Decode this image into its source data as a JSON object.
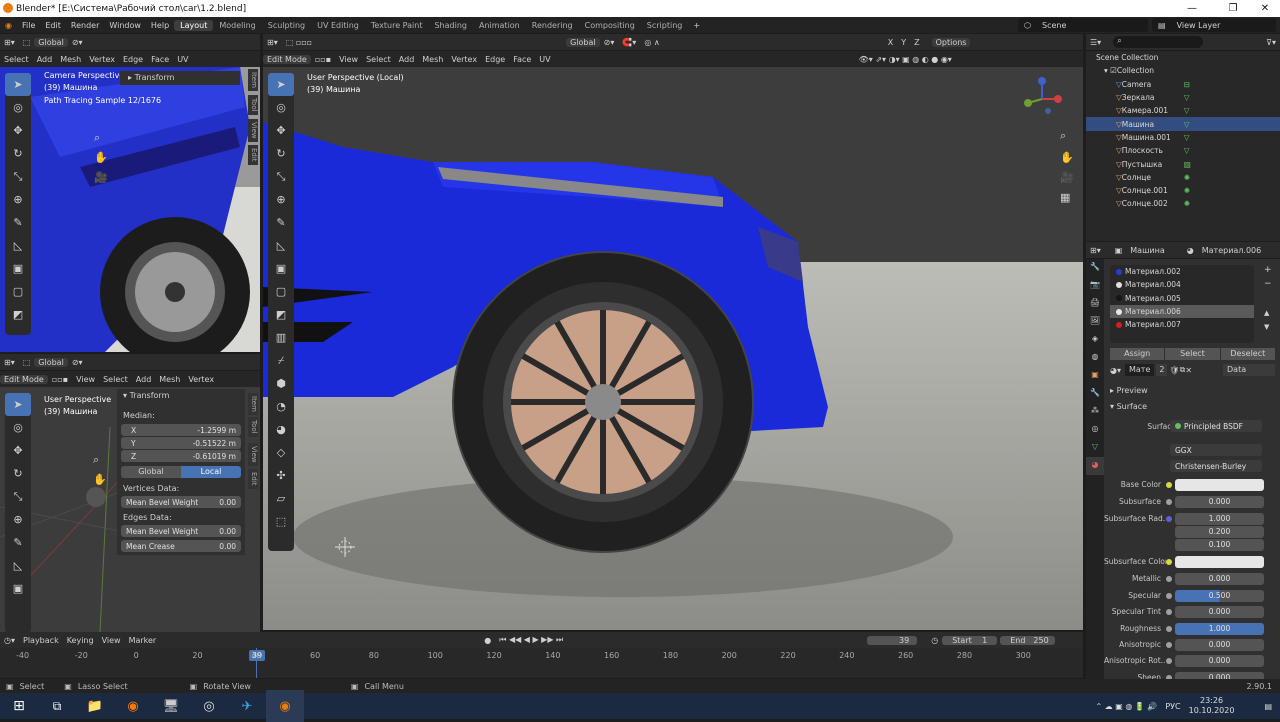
{
  "window": {
    "title": "Blender* [E:\\Система\\Рабочий стол\\car\\1.2.blend]",
    "minimize": "—",
    "maximize": "❐",
    "close": "✕"
  },
  "menu": {
    "items": [
      "File",
      "Edit",
      "Render",
      "Window",
      "Help"
    ],
    "workspaces": [
      "Layout",
      "Modeling",
      "Sculpting",
      "UV Editing",
      "Texture Paint",
      "Shading",
      "Animation",
      "Rendering",
      "Compositing",
      "Scripting"
    ],
    "active_workspace": "Layout",
    "add_tab": "+",
    "scene": "Scene",
    "view_layer": "View Layer"
  },
  "topleft_vp": {
    "orientation": "Global",
    "mode_menu": [
      "Select",
      "Add",
      "Mesh",
      "Vertex",
      "Edge",
      "Face",
      "UV"
    ],
    "info": [
      "Camera Perspective",
      "(39) Машина",
      "Path Tracing Sample 12/1676"
    ],
    "npanel_title": "Transform",
    "tabs": [
      "Item",
      "Tool",
      "View",
      "Edit"
    ]
  },
  "main_vp": {
    "mode": "Edit Mode",
    "menus": [
      "View",
      "Select",
      "Add",
      "Mesh",
      "Vertex",
      "Edge",
      "Face",
      "UV"
    ],
    "orientation": "Global",
    "info": [
      "User Perspective (Local)",
      "(39) Машина"
    ],
    "axes": [
      "X",
      "Y",
      "Z"
    ],
    "options": "Options"
  },
  "bottomleft_vp": {
    "orientation": "Global",
    "mode": "Edit Mode",
    "menus": [
      "View",
      "Select",
      "Add",
      "Mesh",
      "Vertex"
    ],
    "info": [
      "User Perspective",
      "(39) Машина"
    ],
    "tabs": [
      "Item",
      "Tool",
      "View",
      "Edit"
    ],
    "transform": {
      "title": "Transform",
      "median": "Median:",
      "fields": [
        {
          "label": "X",
          "value": "-1.2599 m"
        },
        {
          "label": "Y",
          "value": "-0.51522 m"
        },
        {
          "label": "Z",
          "value": "-0.61019 m"
        }
      ],
      "global": "Global",
      "local": "Local",
      "vertices_data": "Vertices Data:",
      "mean_bevel_weight_label": "Mean Bevel Weight",
      "mean_bevel_weight_v": "0.00",
      "edges_data": "Edges Data:",
      "edge_bevel_label": "Mean Bevel Weight",
      "edge_bevel_v": "0.00",
      "crease_label": "Mean Crease",
      "crease_v": "0.00"
    }
  },
  "outliner": {
    "root": "Scene Collection",
    "collection": "Collection",
    "items": [
      {
        "name": "Camera",
        "color": "#6a9bd8"
      },
      {
        "name": "Зеркала",
        "color": "#e0a060"
      },
      {
        "name": "Камера.001",
        "color": "#e0a060"
      },
      {
        "name": "Машина",
        "color": "#e0a060",
        "selected": true
      },
      {
        "name": "Машина.001",
        "color": "#e0a060"
      },
      {
        "name": "Плоскость",
        "color": "#e0a060"
      },
      {
        "name": "Пустышка",
        "color": "#e0a060"
      },
      {
        "name": "Солнце",
        "color": "#e0a060"
      },
      {
        "name": "Солнце.001",
        "color": "#e0a060"
      },
      {
        "name": "Солнце.002",
        "color": "#e0a060"
      }
    ]
  },
  "properties": {
    "object": "Машина",
    "material": "Материал.006",
    "slots": [
      {
        "name": "Материал.002",
        "color": "#2a3ad8"
      },
      {
        "name": "Материал.004",
        "color": "#e0e0e0"
      },
      {
        "name": "Материал.005",
        "color": "#151515"
      },
      {
        "name": "Материал.006",
        "color": "#e8e8e8",
        "selected": true
      },
      {
        "name": "Материал.007",
        "color": "#d02020"
      }
    ],
    "assign": "Assign",
    "select": "Select",
    "deselect": "Deselect",
    "mate": "Мате",
    "users": "2",
    "data": "Data",
    "preview": "Preview",
    "surface_section": "Surface",
    "surface_label": "Surface",
    "surface_value": "Principled BSDF",
    "dist": "GGX",
    "sss_method": "Christensen-Burley",
    "rows": [
      {
        "label": "Base Color",
        "value": "",
        "kind": "color"
      },
      {
        "label": "Subsurface",
        "value": "0.000"
      },
      {
        "label": "Subsurface Rad...",
        "value": "1.000"
      },
      {
        "label": "",
        "value": "0.200"
      },
      {
        "label": "",
        "value": "0.100"
      },
      {
        "label": "Subsurface Color",
        "value": "",
        "kind": "color"
      },
      {
        "label": "Metallic",
        "value": "0.000"
      },
      {
        "label": "Specular",
        "value": "0.500",
        "fill": 0.5
      },
      {
        "label": "Specular Tint",
        "value": "0.000"
      },
      {
        "label": "Roughness",
        "value": "1.000",
        "fill": 1.0
      },
      {
        "label": "Anisotropic",
        "value": "0.000"
      },
      {
        "label": "Anisotropic Rot...",
        "value": "0.000"
      },
      {
        "label": "Sheen",
        "value": "0.000"
      }
    ]
  },
  "timeline": {
    "menus": [
      "Playback",
      "Keying",
      "View",
      "Marker"
    ],
    "frame": "39",
    "start_label": "Start",
    "start": "1",
    "end_label": "End",
    "end": "250",
    "ticks": [
      "-40",
      "-20",
      "0",
      "20",
      "40",
      "60",
      "80",
      "100",
      "120",
      "140",
      "160",
      "180",
      "200",
      "220",
      "240",
      "260",
      "280",
      "300"
    ],
    "current": "39"
  },
  "status": {
    "select": "Select",
    "lasso": "Lasso Select",
    "rotate": "Rotate View",
    "call": "Call Menu",
    "version": "2.90.1"
  },
  "taskbar": {
    "lang": "РУС",
    "time": "23:26",
    "date": "10.10.2020"
  }
}
